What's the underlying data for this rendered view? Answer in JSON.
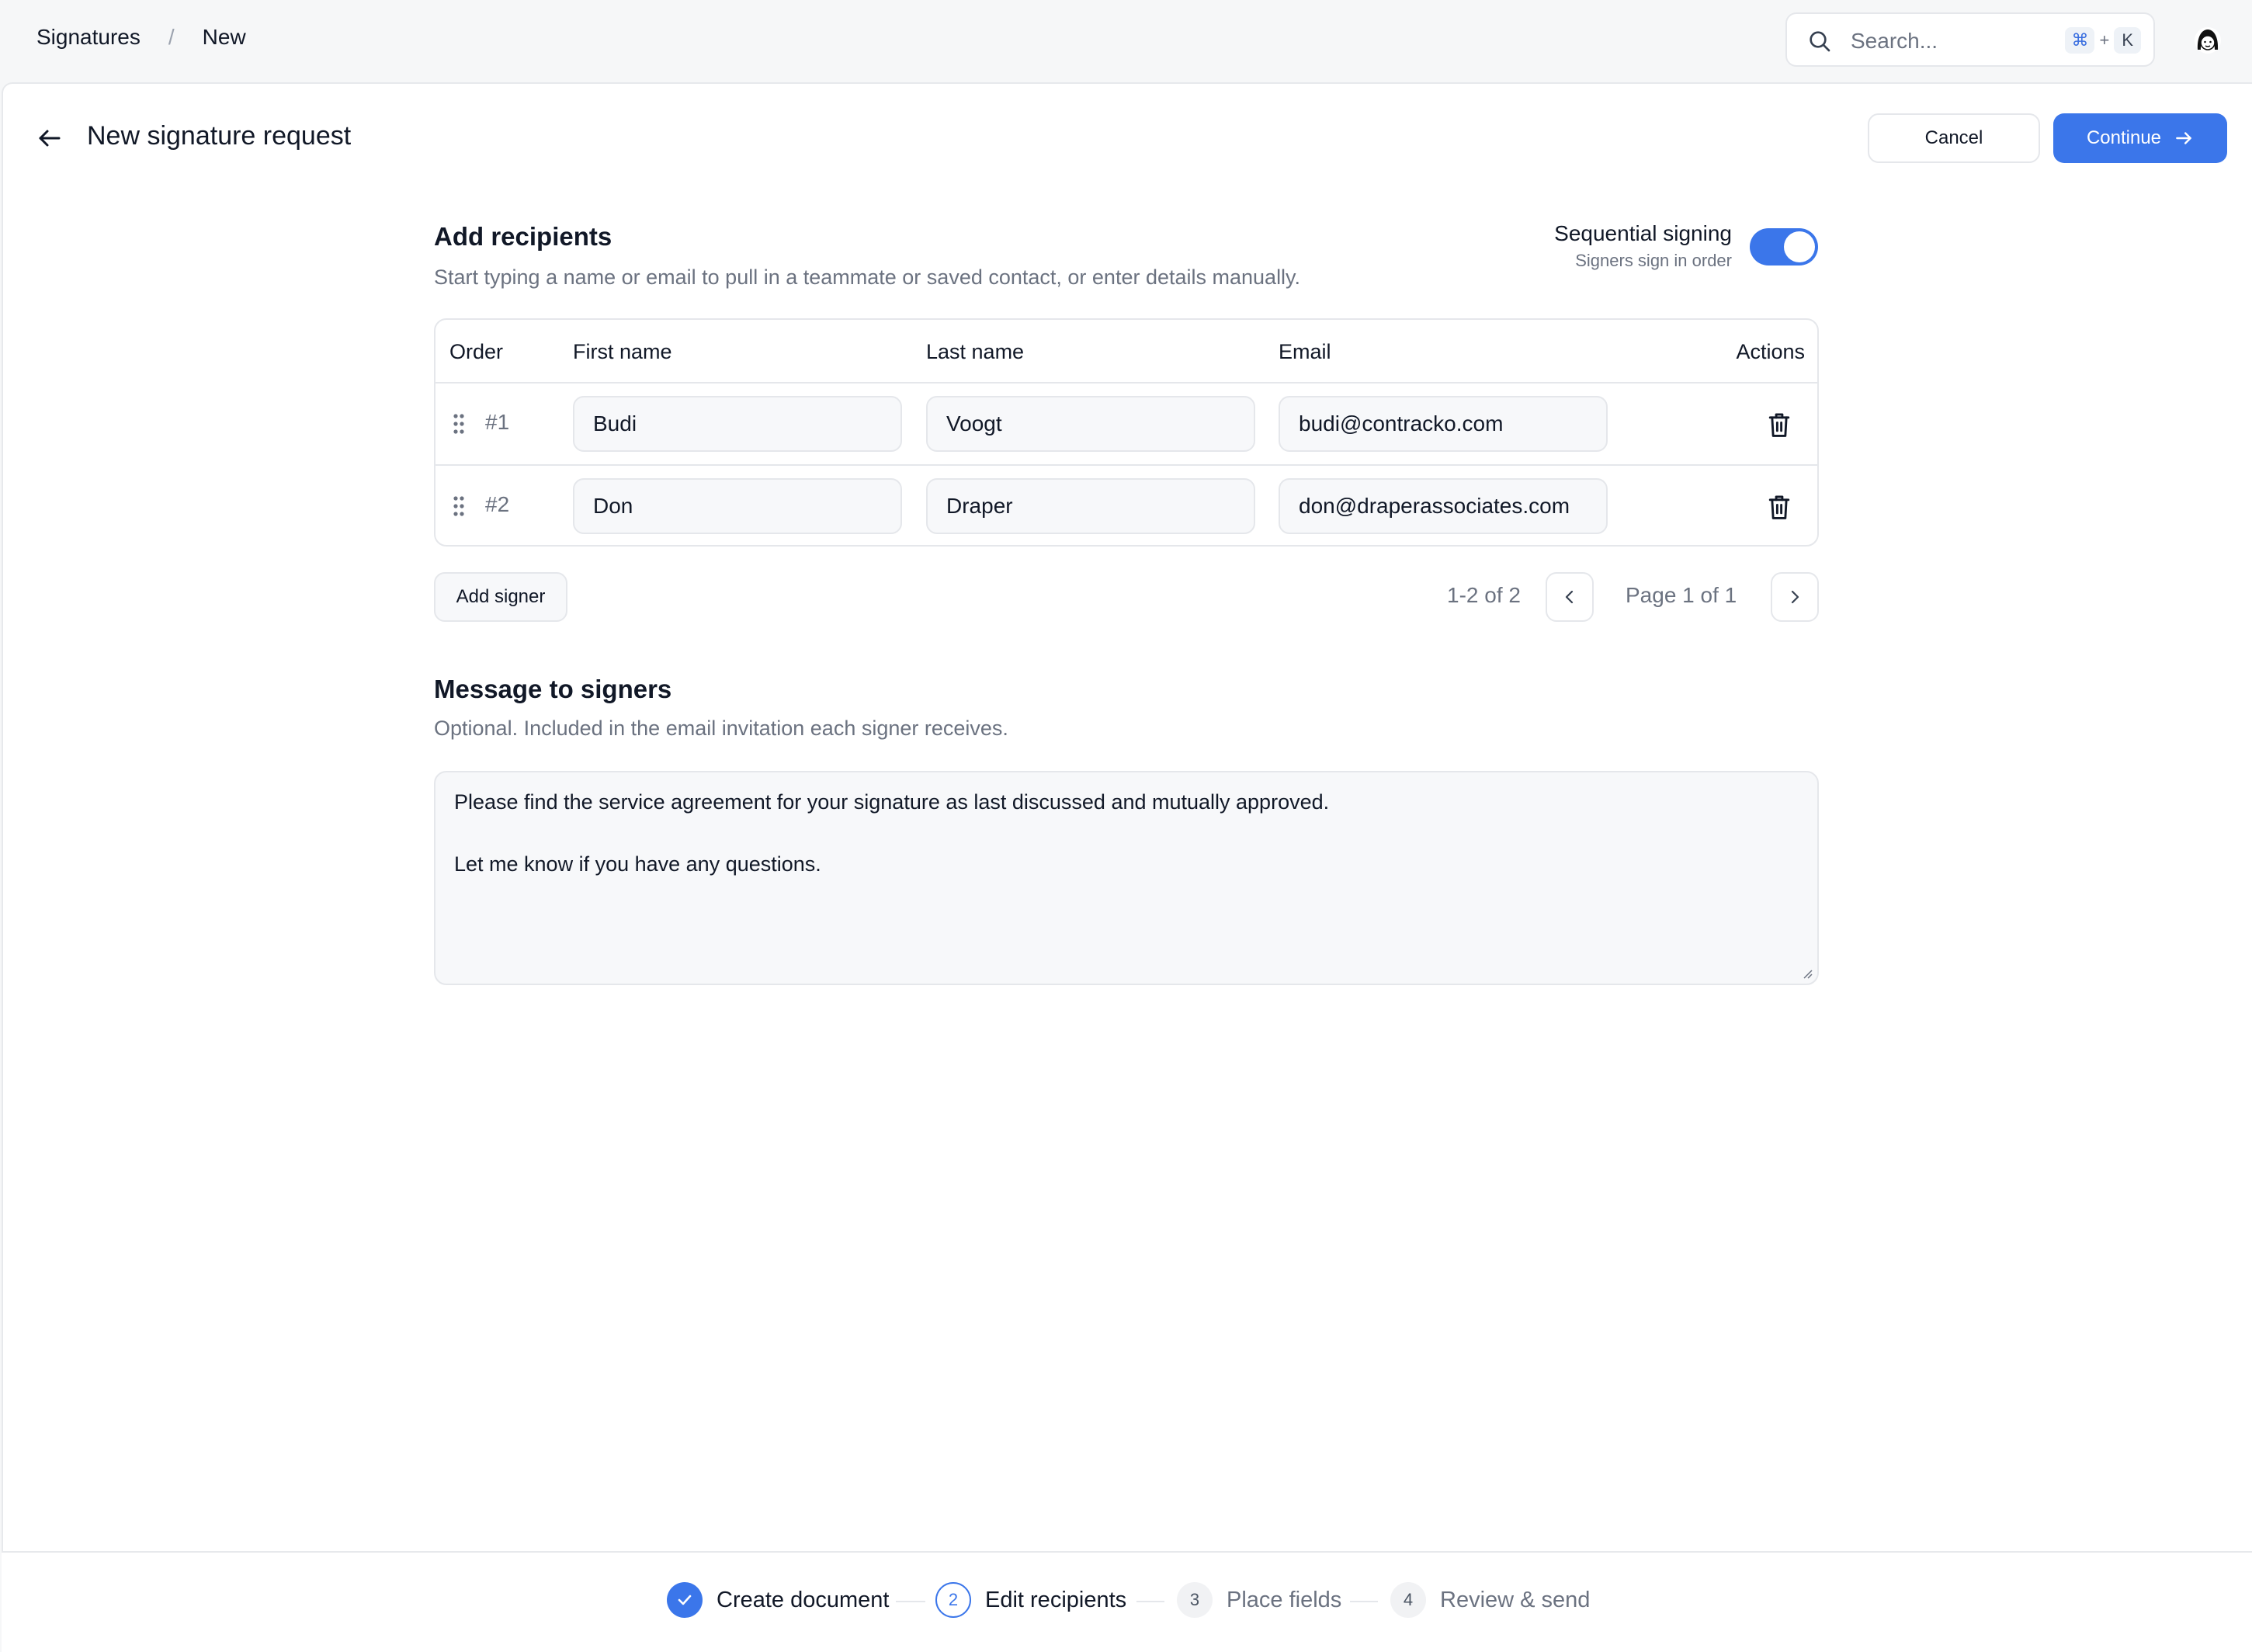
{
  "breadcrumb": {
    "root": "Signatures",
    "separator": "/",
    "current": "New"
  },
  "search": {
    "placeholder": "Search...",
    "shortcut_mod": "⌘",
    "shortcut_plus": "+",
    "shortcut_key": "K"
  },
  "header": {
    "title": "New signature request",
    "cancel_label": "Cancel",
    "continue_label": "Continue"
  },
  "recipients": {
    "title": "Add recipients",
    "subtitle": "Start typing a name or email to pull in a teammate or saved contact, or enter details manually.",
    "sequential": {
      "label": "Sequential signing",
      "sub": "Signers sign in order",
      "enabled": true
    },
    "columns": {
      "order": "Order",
      "first": "First name",
      "last": "Last name",
      "email": "Email",
      "actions": "Actions"
    },
    "rows": [
      {
        "order": "#1",
        "first": "Budi",
        "last": "Voogt",
        "email": "budi@contracko.com"
      },
      {
        "order": "#2",
        "first": "Don",
        "last": "Draper",
        "email": "don@draperassociates.com"
      }
    ],
    "add_label": "Add signer",
    "pagination": {
      "range": "1-2 of 2",
      "page": "Page 1 of 1"
    }
  },
  "message": {
    "title": "Message to signers",
    "subtitle": "Optional. Included in the email invitation each signer receives.",
    "body": "Please find the service agreement for your signature as last discussed and mutually approved.\n\nLet me know if you have any questions."
  },
  "steps": [
    {
      "label": "Create document",
      "num": "1",
      "state": "done"
    },
    {
      "label": "Edit recipients",
      "num": "2",
      "state": "active"
    },
    {
      "label": "Place fields",
      "num": "3",
      "state": "todo"
    },
    {
      "label": "Review & send",
      "num": "4",
      "state": "todo"
    }
  ],
  "colors": {
    "accent": "#3b76ea",
    "muted": "#6b7280",
    "border": "#e5e7eb"
  }
}
